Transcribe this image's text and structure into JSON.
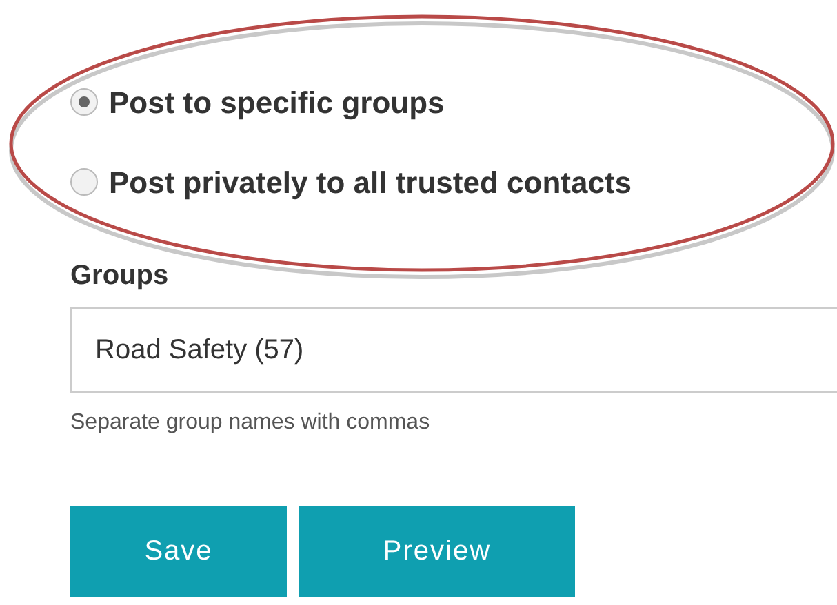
{
  "options": [
    {
      "label": "Post to specific groups",
      "selected": true
    },
    {
      "label": "Post privately to all trusted contacts",
      "selected": false
    }
  ],
  "groups": {
    "label": "Groups",
    "value": "Road Safety (57)",
    "hint": "Separate group names with commas"
  },
  "buttons": [
    "Save",
    "Preview"
  ]
}
